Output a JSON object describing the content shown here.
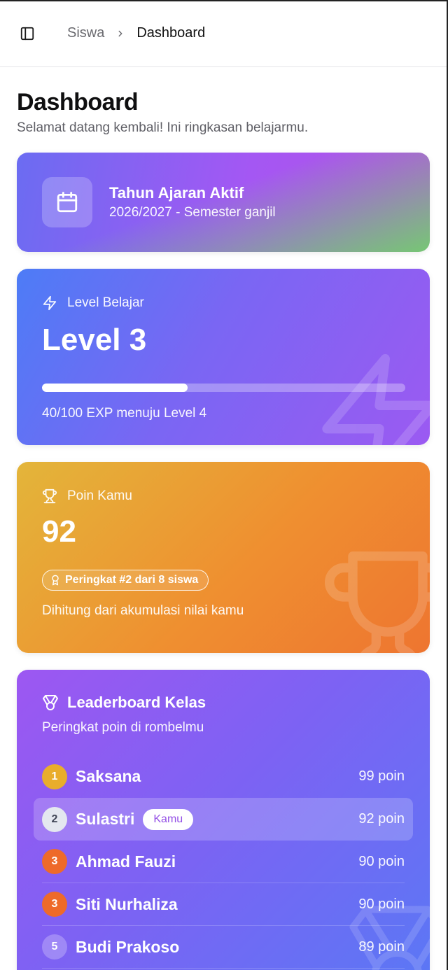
{
  "header": {
    "breadcrumb_parent": "Siswa",
    "breadcrumb_current": "Dashboard"
  },
  "page": {
    "title": "Dashboard",
    "subtitle": "Selamat datang kembali! Ini ringkasan belajarmu."
  },
  "academic_year": {
    "title": "Tahun Ajaran Aktif",
    "value": "2026/2027 - Semester ganjil"
  },
  "level": {
    "label": "Level Belajar",
    "value": "Level 3",
    "progress": 0.4,
    "caption": "40/100 EXP menuju Level 4"
  },
  "points": {
    "label": "Poin Kamu",
    "value": "92",
    "rank_badge": "Peringkat #2 dari 8 siswa",
    "caption": "Dihitung dari akumulasi nilai kamu"
  },
  "leaderboard": {
    "title": "Leaderboard Kelas",
    "subtitle": "Peringkat poin di rombelmu",
    "you_label": "Kamu",
    "rows": [
      {
        "rank": "1",
        "name": "Saksana",
        "points": "99 poin"
      },
      {
        "rank": "2",
        "name": "Sulastri",
        "points": "92 poin"
      },
      {
        "rank": "3",
        "name": "Ahmad Fauzi",
        "points": "90 poin"
      },
      {
        "rank": "3",
        "name": "Siti Nurhaliza",
        "points": "90 poin"
      },
      {
        "rank": "5",
        "name": "Budi Prakoso",
        "points": "89 poin"
      }
    ]
  },
  "icons": {
    "sidebar": "sidebar-toggle-icon",
    "chevron": "chevron-right-icon",
    "calendar": "calendar-icon",
    "bolt": "zap-icon",
    "trophy": "trophy-icon",
    "award": "award-icon",
    "medal": "medal-icon"
  },
  "colors": {
    "rank_gold": "#e9ad2c",
    "rank_silver": "#e4e8ef",
    "rank_bronze": "#ee6a2a",
    "you_badge_text": "#9450e6"
  }
}
